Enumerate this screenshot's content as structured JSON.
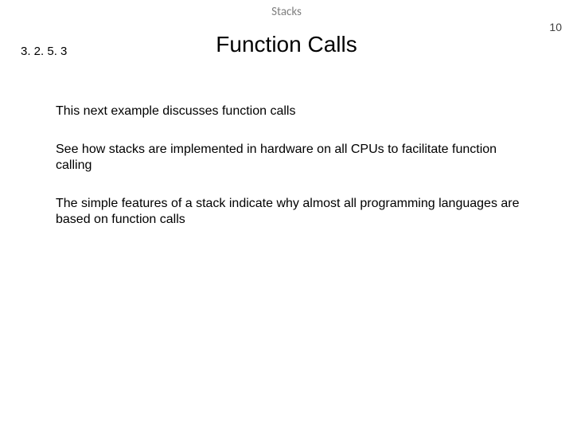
{
  "header": {
    "topic": "Stacks",
    "page_number": "10"
  },
  "section_number": "3. 2. 5. 3",
  "title": "Function Calls",
  "body": {
    "paragraphs": [
      "This next example discusses function calls",
      "See how stacks are implemented in hardware on all CPUs to facilitate function calling",
      "The simple features of a stack indicate why almost all programming languages are based on function calls"
    ]
  }
}
